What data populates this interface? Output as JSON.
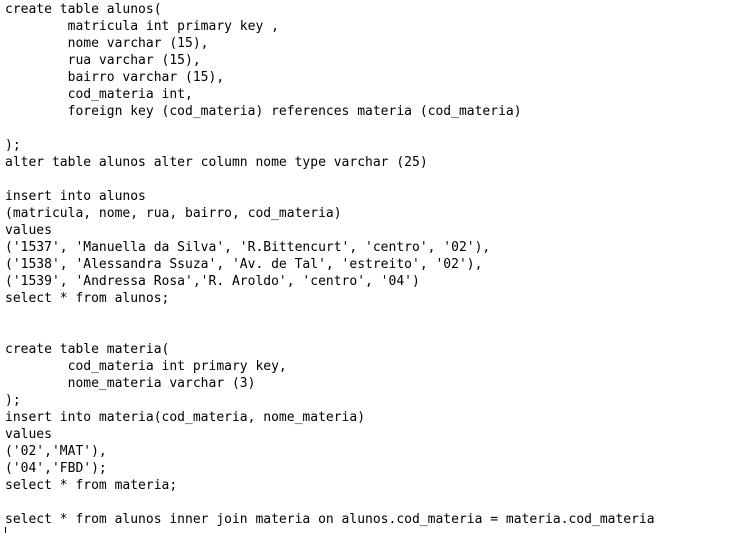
{
  "editor": {
    "lines": [
      "create table alunos(",
      "        matricula int primary key ,",
      "        nome varchar (15),",
      "        rua varchar (15),",
      "        bairro varchar (15),",
      "        cod_materia int,",
      "        foreign key (cod_materia) references materia (cod_materia)",
      "",
      ");",
      "alter table alunos alter column nome type varchar (25)",
      "",
      "insert into alunos",
      "(matricula, nome, rua, bairro, cod_materia)",
      "values",
      "('1537', 'Manuella da Silva', 'R.Bittencurt', 'centro', '02'),",
      "('1538', 'Alessandra Ssuza', 'Av. de Tal', 'estreito', '02'),",
      "('1539', 'Andressa Rosa','R. Aroldo', 'centro', '04')",
      "select * from alunos;",
      "",
      "",
      "create table materia(",
      "        cod_materia int primary key,",
      "        nome_materia varchar (3)",
      ");",
      "insert into materia(cod_materia, nome_materia)",
      "values",
      "('02','MAT'),",
      "('04','FBD');",
      "select * from materia;",
      "",
      "select * from alunos inner join materia on alunos.cod_materia = materia.cod_materia"
    ]
  }
}
